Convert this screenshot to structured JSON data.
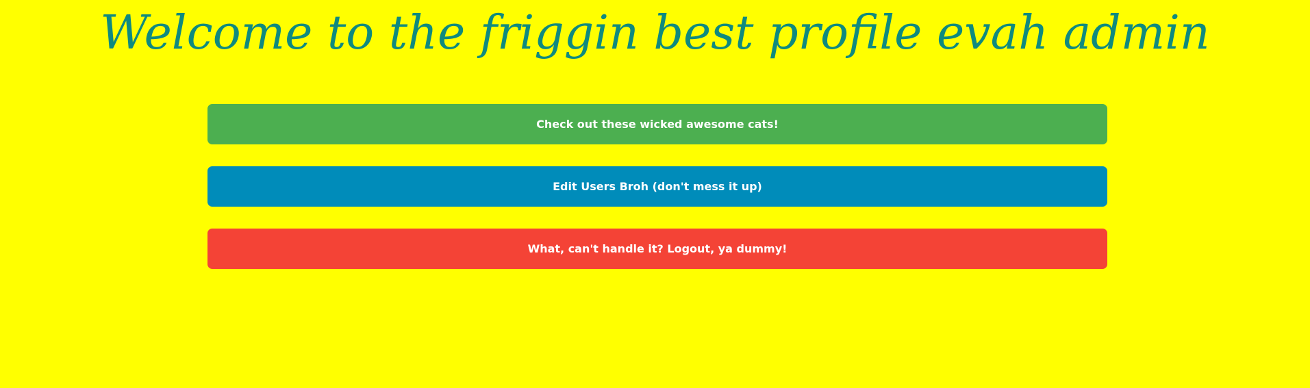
{
  "page": {
    "title": "Welcome to the friggin best profile evah admin",
    "background_color": "#ffff00",
    "title_color": "#0f8a7f"
  },
  "actions": [
    {
      "label": "Check out these wicked awesome cats!",
      "color": "#4caf50"
    },
    {
      "label": "Edit Users Broh (don't mess it up)",
      "color": "#008cba"
    },
    {
      "label": "What, can't handle it? Logout, ya dummy!",
      "color": "#f44336"
    }
  ]
}
